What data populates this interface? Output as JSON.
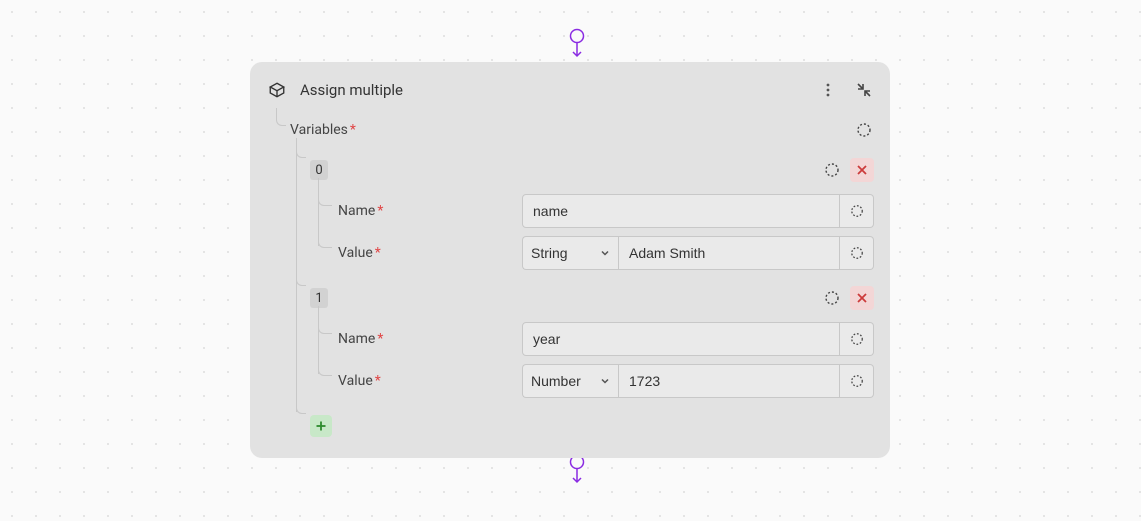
{
  "node": {
    "title": "Assign multiple",
    "section_label": "Variables",
    "required_mark": "*",
    "variables": [
      {
        "index": "0",
        "name_label": "Name",
        "name_value": "name",
        "value_label": "Value",
        "type_selected": "String",
        "value_value": "Adam Smith"
      },
      {
        "index": "1",
        "name_label": "Name",
        "name_value": "year",
        "value_label": "Value",
        "type_selected": "Number",
        "value_value": "1723"
      }
    ]
  }
}
